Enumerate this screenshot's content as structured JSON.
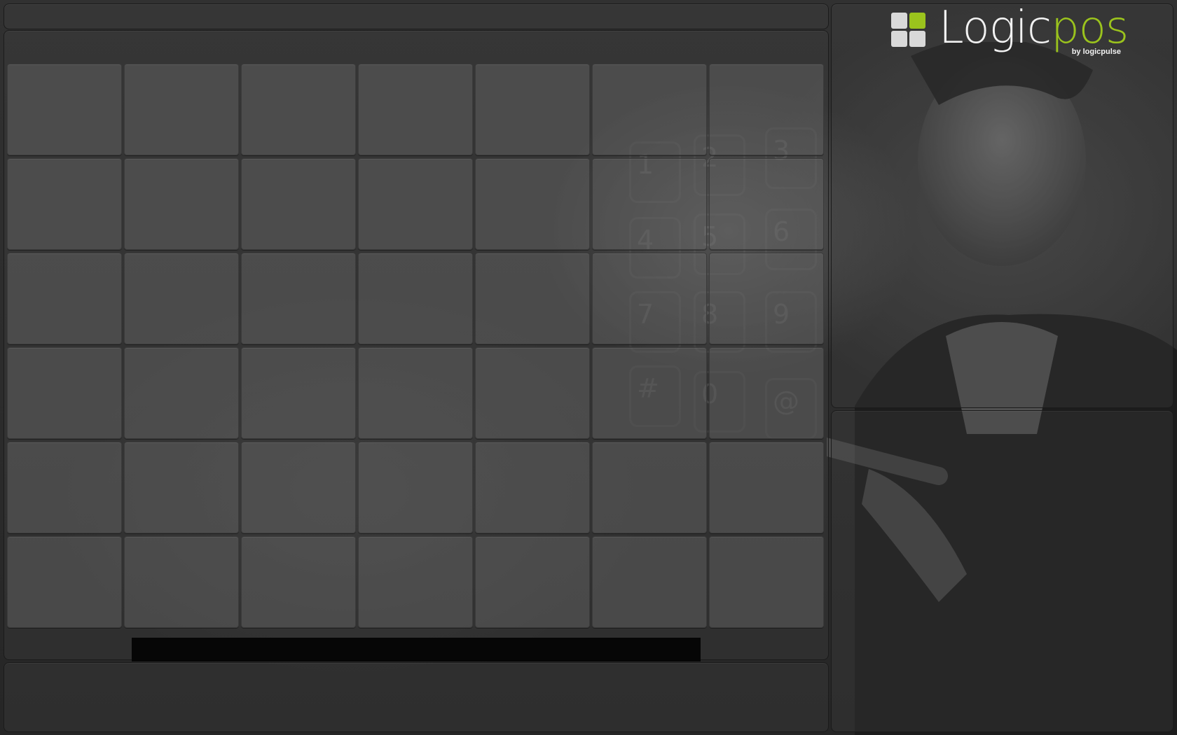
{
  "app": {
    "logo": {
      "word_part1": "Logic",
      "word_part2": "pos",
      "byline": "by  logicpulse",
      "mark_colors": [
        "#d9d9d9",
        "#9bc31d",
        "#d9d9d9",
        "#d9d9d9"
      ],
      "accent_color": "#9bc31d"
    }
  },
  "background_keypad": [
    "1",
    "2",
    "3",
    "4",
    "5",
    "6",
    "7",
    "8",
    "9",
    "#",
    "0",
    "@"
  ],
  "button_grid": {
    "columns": 7,
    "rows": 6,
    "buttons": [
      "",
      "",
      "",
      "",
      "",
      "",
      "",
      "",
      "",
      "",
      "",
      "",
      "",
      "",
      "",
      "",
      "",
      "",
      "",
      "",
      "",
      "",
      "",
      "",
      "",
      "",
      "",
      "",
      "",
      "",
      "",
      "",
      "",
      "",
      "",
      "",
      "",
      "",
      "",
      "",
      "",
      ""
    ]
  },
  "colors": {
    "background": "#2a2a2a",
    "tile": "#5e5e5e",
    "accent": "#9bc31d"
  }
}
